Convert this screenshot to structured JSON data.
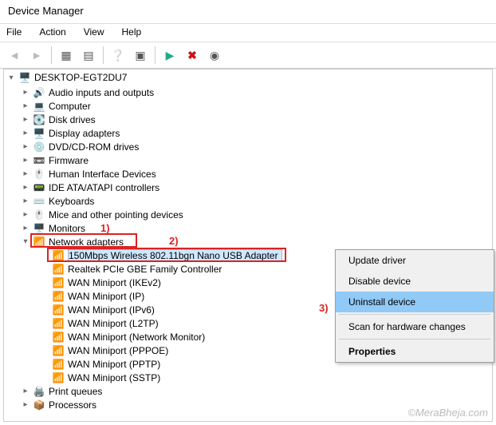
{
  "window": {
    "title": "Device Manager"
  },
  "menu": {
    "file": "File",
    "action": "Action",
    "view": "View",
    "help": "Help"
  },
  "root": {
    "name": "DESKTOP-EGT2DU7"
  },
  "categories": [
    {
      "label": "Audio inputs and outputs",
      "key": "audio"
    },
    {
      "label": "Computer",
      "key": "computer"
    },
    {
      "label": "Disk drives",
      "key": "disk"
    },
    {
      "label": "Display adapters",
      "key": "display"
    },
    {
      "label": "DVD/CD-ROM drives",
      "key": "dvd"
    },
    {
      "label": "Firmware",
      "key": "firmware"
    },
    {
      "label": "Human Interface Devices",
      "key": "hid"
    },
    {
      "label": "IDE ATA/ATAPI controllers",
      "key": "ide"
    },
    {
      "label": "Keyboards",
      "key": "keyboard"
    },
    {
      "label": "Mice and other pointing devices",
      "key": "mouse"
    },
    {
      "label": "Monitors",
      "key": "monitor"
    },
    {
      "label": "Network adapters",
      "key": "network",
      "expanded": true
    },
    {
      "label": "Print queues",
      "key": "print"
    },
    {
      "label": "Processors",
      "key": "cpu"
    }
  ],
  "network_devices": [
    {
      "label": "150Mbps Wireless 802.11bgn Nano USB Adapter",
      "selected": true
    },
    {
      "label": "Realtek PCIe GBE Family Controller"
    },
    {
      "label": "WAN Miniport (IKEv2)"
    },
    {
      "label": "WAN Miniport (IP)"
    },
    {
      "label": "WAN Miniport (IPv6)"
    },
    {
      "label": "WAN Miniport (L2TP)"
    },
    {
      "label": "WAN Miniport (Network Monitor)"
    },
    {
      "label": "WAN Miniport (PPPOE)"
    },
    {
      "label": "WAN Miniport (PPTP)"
    },
    {
      "label": "WAN Miniport (SSTP)"
    }
  ],
  "contextmenu": {
    "update": "Update driver",
    "disable": "Disable device",
    "uninstall": "Uninstall device",
    "scan": "Scan for hardware changes",
    "properties": "Properties"
  },
  "annotations": {
    "one": "1)",
    "two": "2)",
    "three": "3)"
  },
  "watermark": "©MeraBheja.com"
}
